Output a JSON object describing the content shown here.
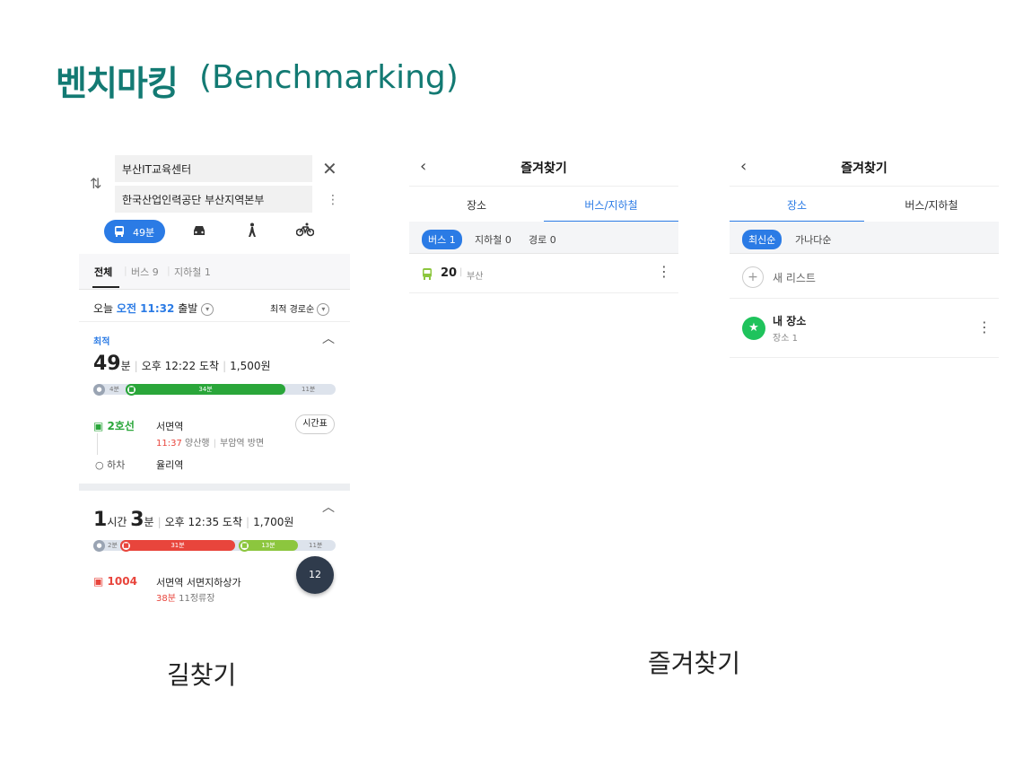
{
  "slide": {
    "title_ko": "벤치마킹",
    "title_en": "(Benchmarking)",
    "caption_left": "길찾기",
    "caption_right": "즐겨찾기"
  },
  "route_screen": {
    "origin": "부산IT교육센터",
    "destination": "한국산업인력공단 부산지역본부",
    "mode_selected_label": "49분",
    "modes": [
      "bus-icon",
      "car-icon",
      "walk-icon",
      "bicycle-icon"
    ],
    "tabs": [
      {
        "label": "전체",
        "active": true
      },
      {
        "label": "버스 9",
        "active": false
      },
      {
        "label": "지하철 1",
        "active": false
      }
    ],
    "depart": {
      "prefix": "오늘",
      "time": "오전 11:32",
      "suffix": "출발",
      "sort": "최적 경로순"
    },
    "route1": {
      "tag": "최적",
      "duration_num": "49",
      "duration_unit": "분",
      "arrival": "오후 12:22 도착",
      "fare": "1,500원",
      "bar": {
        "walk1": "4분",
        "ride": "34분",
        "walk2": "11분"
      },
      "line": "2호선",
      "board_station": "서면역",
      "timetable_button": "시간표",
      "next_time": "11:37",
      "direction": "양산행",
      "platform": "부암역 방면",
      "alight_label": "하차",
      "alight_station": "율리역"
    },
    "route2": {
      "h_num": "1",
      "h_unit": "시간",
      "m_num": "3",
      "m_unit": "분",
      "arrival": "오후 12:35 도착",
      "fare": "1,700원",
      "bar": {
        "walk1": "2분",
        "ride1": "31분",
        "ride2": "13분",
        "walk2": "11분"
      },
      "bus": "1004",
      "station": "서면역 서면지하상가",
      "wait": "38분",
      "stops": "11정류장",
      "fab": "12"
    }
  },
  "fav_bus_screen": {
    "title": "즐겨찾기",
    "tabs": [
      {
        "label": "장소",
        "active": false
      },
      {
        "label": "버스/지하철",
        "active": true
      }
    ],
    "filters": [
      {
        "label": "버스 1",
        "on": true
      },
      {
        "label": "지하철 0",
        "on": false
      },
      {
        "label": "경로 0",
        "on": false
      }
    ],
    "item": {
      "number": "20",
      "region": "부산"
    }
  },
  "fav_place_screen": {
    "title": "즐겨찾기",
    "tabs": [
      {
        "label": "장소",
        "active": true
      },
      {
        "label": "버스/지하철",
        "active": false
      }
    ],
    "filters": [
      {
        "label": "최신순",
        "on": true
      },
      {
        "label": "가나다순",
        "on": false
      }
    ],
    "new_list": "새 리스트",
    "item": {
      "name": "내 장소",
      "sub": "장소 1"
    }
  },
  "colors": {
    "brand_title": "#137a73",
    "accent_blue": "#2b7be5",
    "subway_green": "#2aa63a",
    "bus_red": "#e8453c",
    "bus_lime": "#8cc63e"
  }
}
